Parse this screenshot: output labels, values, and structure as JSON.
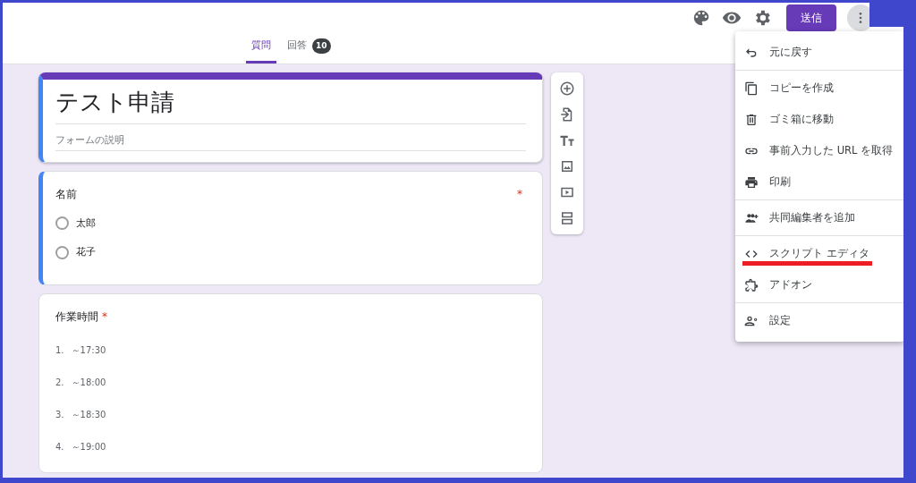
{
  "header": {
    "send_button": "送信"
  },
  "tabs": [
    {
      "label": "質問",
      "selected": true
    },
    {
      "label": "回答",
      "selected": false,
      "badge": "10"
    }
  ],
  "form": {
    "title": "テスト申請",
    "description_placeholder": "フォームの説明"
  },
  "questions": [
    {
      "kind": "choice",
      "title": "名前",
      "required": true,
      "required_mark": "*",
      "focused": true,
      "options": [
        {
          "label": "太郎",
          "checked": false
        },
        {
          "label": "花子",
          "checked": false
        }
      ]
    },
    {
      "kind": "list",
      "title": "作業時間",
      "required": true,
      "required_mark": "*",
      "focused": false,
      "options": [
        {
          "number": "1.",
          "label": "～17:30"
        },
        {
          "number": "2.",
          "label": "～18:00"
        },
        {
          "number": "3.",
          "label": "～18:30"
        },
        {
          "number": "4.",
          "label": "～19:00"
        }
      ]
    }
  ],
  "menu": {
    "groups": [
      [
        {
          "label": "元に戻す",
          "underlined": false
        }
      ],
      [
        {
          "label": "コピーを作成",
          "underlined": false
        },
        {
          "label": "ゴミ箱に移動",
          "underlined": false
        },
        {
          "label": "事前入力した URL を取得",
          "underlined": false
        },
        {
          "label": "印刷",
          "underlined": false
        }
      ],
      [
        {
          "label": "共同編集者を追加",
          "underlined": false
        }
      ],
      [
        {
          "label": "スクリプト エディタ",
          "underlined": true
        },
        {
          "label": "アドオン",
          "underlined": false
        }
      ],
      [
        {
          "label": "設定",
          "underlined": false
        }
      ]
    ]
  }
}
